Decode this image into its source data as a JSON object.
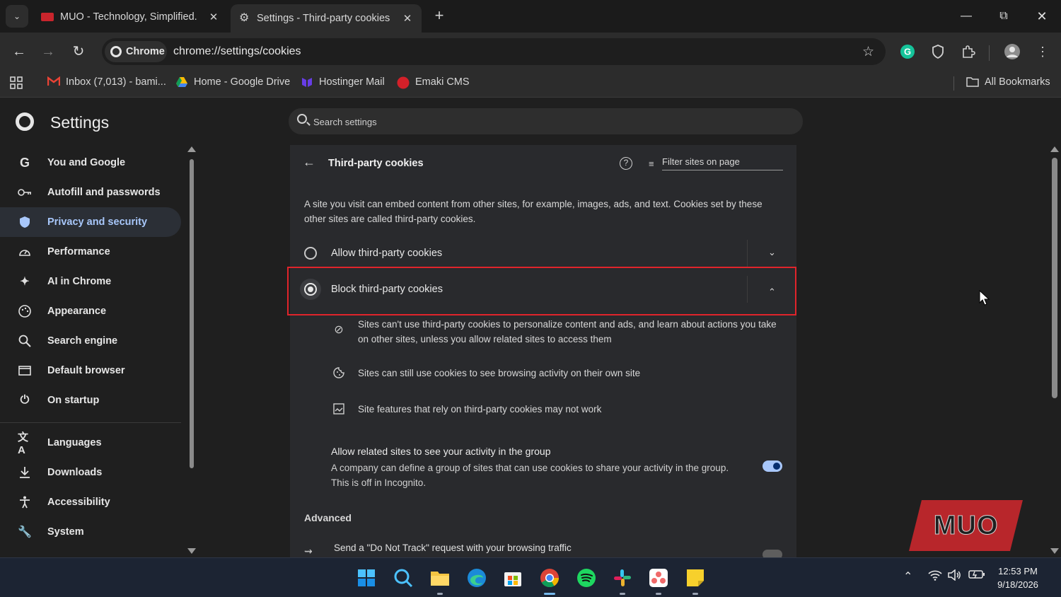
{
  "tabs": [
    {
      "title": "MUO - Technology, Simplified.",
      "active": false,
      "favicon": "muo-favicon-icon"
    },
    {
      "title": "Settings - Third-party cookies",
      "active": true,
      "favicon": "gear-icon"
    }
  ],
  "toolbar": {
    "chip_label": "Chrome",
    "url": "chrome://settings/cookies"
  },
  "bookmarks": {
    "items": [
      {
        "label": "Inbox (7,013) - bami...",
        "icon": "gmail-icon"
      },
      {
        "label": "Home - Google Drive",
        "icon": "google-drive-icon"
      },
      {
        "label": "Hostinger Mail",
        "icon": "hostinger-icon"
      },
      {
        "label": "Emaki CMS",
        "icon": "emaki-icon"
      }
    ],
    "all_label": "All Bookmarks"
  },
  "settings": {
    "title": "Settings",
    "search_placeholder": "Search settings",
    "sidebar": [
      {
        "label": "You and Google",
        "icon": "google-g-icon",
        "active": false
      },
      {
        "label": "Autofill and passwords",
        "icon": "key-icon",
        "active": false
      },
      {
        "label": "Privacy and security",
        "icon": "shield-icon",
        "active": true
      },
      {
        "label": "Performance",
        "icon": "speedometer-icon",
        "active": false
      },
      {
        "label": "AI in Chrome",
        "icon": "sparkle-icon",
        "active": false
      },
      {
        "label": "Appearance",
        "icon": "palette-icon",
        "active": false
      },
      {
        "label": "Search engine",
        "icon": "search-icon",
        "active": false
      },
      {
        "label": "Default browser",
        "icon": "browser-window-icon",
        "active": false
      },
      {
        "label": "On startup",
        "icon": "power-icon",
        "active": false
      },
      {
        "label": "Languages",
        "icon": "translate-icon",
        "active": false
      },
      {
        "label": "Downloads",
        "icon": "download-icon",
        "active": false
      },
      {
        "label": "Accessibility",
        "icon": "accessibility-icon",
        "active": false
      },
      {
        "label": "System",
        "icon": "wrench-icon",
        "active": false
      }
    ]
  },
  "card": {
    "title": "Third-party cookies",
    "filter_placeholder": "Filter sites on page",
    "description": "A site you visit can embed content from other sites, for example, images, ads, and text. Cookies set by these other sites are called third-party cookies.",
    "options": [
      {
        "label": "Allow third-party cookies",
        "selected": false
      },
      {
        "label": "Block third-party cookies",
        "selected": true
      }
    ],
    "block_details": [
      {
        "icon": "block-icon",
        "text": "Sites can't use third-party cookies to personalize content and ads, and learn about actions you take on other sites, unless you allow related sites to access them"
      },
      {
        "icon": "cookie-icon",
        "text": "Sites can still use cookies to see browsing activity on their own site"
      },
      {
        "icon": "image-broken-icon",
        "text": "Site features that rely on third-party cookies may not work"
      }
    ],
    "related": {
      "title": "Allow related sites to see your activity in the group",
      "description": "A company can define a group of sites that can use cookies to share your activity in the group. This is off in Incognito.",
      "enabled": true
    },
    "advanced_title": "Advanced",
    "dnt_label": "Send a \"Do Not Track\" request with your browsing traffic",
    "dnt_enabled": false
  },
  "watermark": "MUO",
  "taskbar": {
    "time": "12:53 PM",
    "date": "9/18/2026",
    "apps": [
      "windows-start-icon",
      "search-icon",
      "file-explorer-icon",
      "edge-icon",
      "store-icon",
      "chrome-icon",
      "spotify-icon",
      "slack-icon",
      "asana-icon",
      "sticky-notes-icon"
    ]
  },
  "colors": {
    "accent": "#a8c7fa",
    "highlight_border": "#e0242b",
    "page_bg": "#1f1f1f",
    "card_bg": "#292a2d"
  }
}
